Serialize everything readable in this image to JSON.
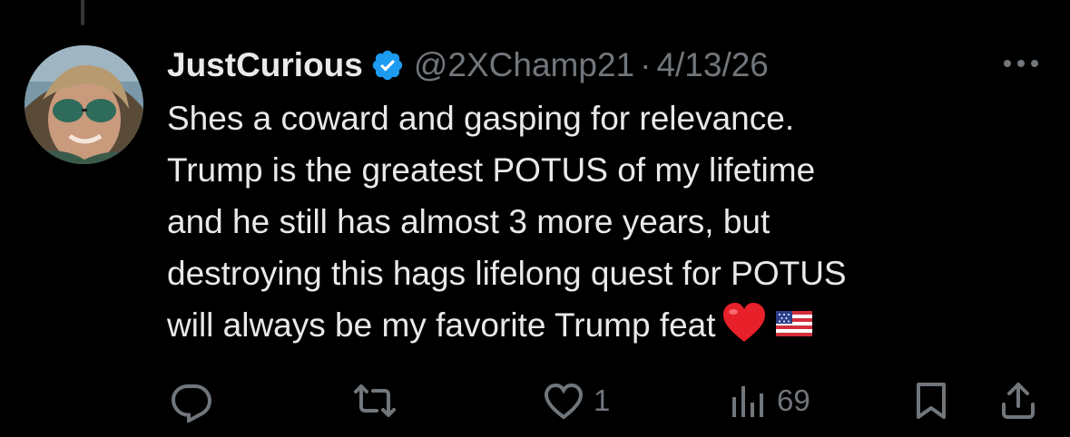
{
  "tweet": {
    "display_name": "JustCurious",
    "handle": "@2XChamp21",
    "separator": "·",
    "date": "4/13/26",
    "text_lines": [
      "Shes a coward and gasping for relevance.",
      "Trump is the greatest POTUS of my lifetime",
      "and he still has almost 3 more years, but",
      "destroying this hags lifelong quest for POTUS",
      "will always be my favorite Trump feat"
    ],
    "emojis": [
      "red-heart",
      "us-flag"
    ]
  },
  "actions": {
    "reply_count": "",
    "repost_count": "",
    "like_count": "1",
    "views_count": "69"
  },
  "icons": {
    "reply": "reply-icon",
    "repost": "repost-icon",
    "like": "heart-icon",
    "views": "views-icon",
    "bookmark": "bookmark-icon",
    "share": "share-icon",
    "more": "more-icon",
    "verified": "verified-badge-icon"
  },
  "colors": {
    "background": "#000000",
    "primary_text": "#e7e9ea",
    "secondary_text": "#71767b",
    "verified_blue": "#1d9bf0"
  }
}
